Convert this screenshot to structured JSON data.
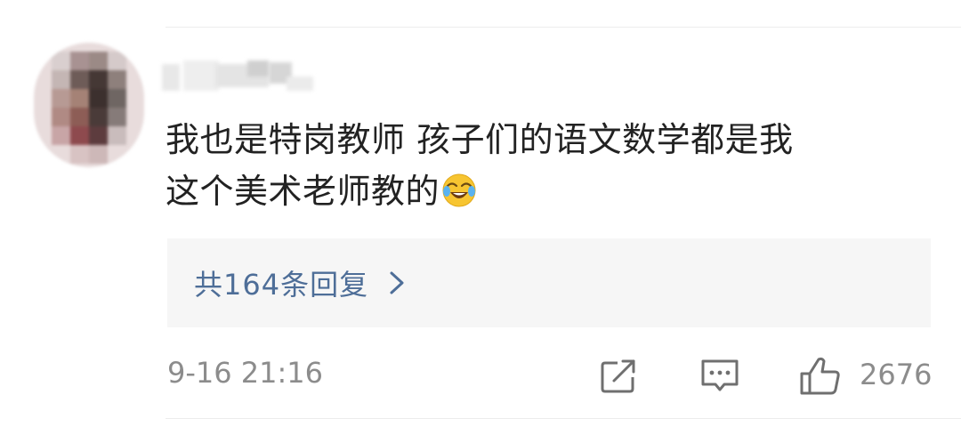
{
  "comment": {
    "line1": "我也是特岗教师  孩子们的语文数学都是我",
    "line2": "这个美术老师教的"
  },
  "replies": {
    "label": "共164条回复"
  },
  "meta": {
    "timestamp": "9-16 21:16",
    "like_count": "2676"
  },
  "icons": {
    "emoji": "laugh-cry-emoji",
    "reply_arrow": "chevron-right-icon",
    "share": "share-icon",
    "comment": "comment-icon",
    "like": "thumbs-up-icon"
  },
  "colors": {
    "reply_link": "#4e6e98",
    "meta_text": "#8c8c8c",
    "reply_box_bg": "#f6f6f6"
  }
}
